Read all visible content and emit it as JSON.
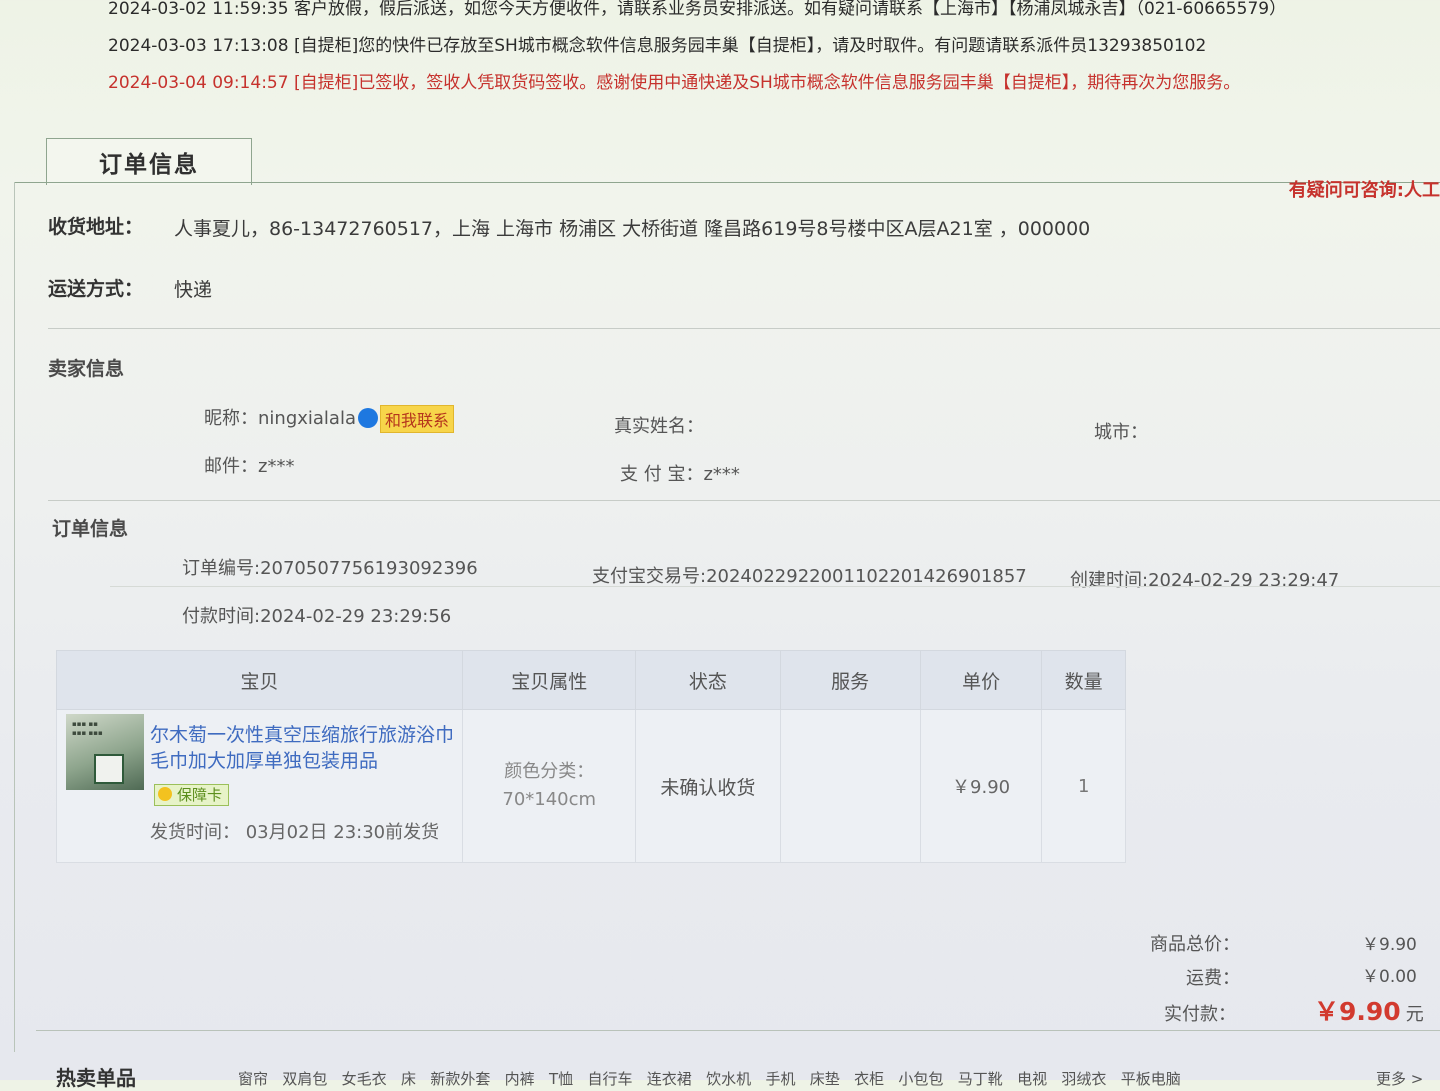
{
  "logistics": [
    {
      "time": "2024-03-02 11:59:35",
      "text": "客户放假，假后派送，如您今天方便收件，请联系业务员安排派送。如有疑问请联系【上海市】【杨浦凤城永吉】（021-60665579）"
    },
    {
      "time": "2024-03-03 17:13:08",
      "text": "[自提柜]您的快件已存放至SH城市概念软件信息服务园丰巢【自提柜】，请及时取件。有问题请联系派件员13293850102"
    },
    {
      "time": "2024-03-04 09:14:57",
      "text": "[自提柜]已签收，签收人凭取货码签收。感谢使用中通快递及SH城市概念软件信息服务园丰巢【自提柜】，期待再次为您服务。"
    }
  ],
  "tab": {
    "label": "订单信息"
  },
  "help": {
    "text": "有疑问可咨询:人工"
  },
  "shipping": {
    "address_label": "收货地址：",
    "address_value": "人事夏儿，86-13472760517，上海 上海市 杨浦区 大桥街道 隆昌路619号8号楼中区A层A21室 ，000000",
    "method_label": "运送方式：",
    "method_value": "快递"
  },
  "seller": {
    "section_title": "卖家信息",
    "nickname_label": "昵称：",
    "nickname": "ningxialala",
    "contact_label": "和我联系",
    "realname_label": "真实姓名：",
    "city_label": "城市：",
    "email_label": "邮件：",
    "email": "z***",
    "alipay_label": "支 付 宝：",
    "alipay": "z***"
  },
  "order": {
    "section_title": "订单信息",
    "order_no_label": "订单编号:",
    "order_no": "2070507756193092396",
    "trade_no_label": "支付宝交易号:",
    "trade_no": "2024022922001102201426901857",
    "created_label": "创建时间:",
    "created": "2024-02-29 23:29:47",
    "paid_label": "付款时间:",
    "paid": "2024-02-29 23:29:56"
  },
  "items_table": {
    "headers": [
      "宝贝",
      "宝贝属性",
      "状态",
      "服务",
      "单价",
      "数量"
    ],
    "rows": [
      {
        "title": "尔木萄一次性真空压缩旅行旅游浴巾毛巾加大加厚单独包装用品",
        "badge": "保障卡",
        "ship_label": "发货时间：",
        "ship_time": "03月02日 23:30前发货",
        "attr_label": "颜色分类：",
        "attr_value": "70*140cm",
        "status": "未确认收货",
        "service": "",
        "price": "￥9.90",
        "qty": "1"
      }
    ]
  },
  "totals": {
    "goods_label": "商品总价：",
    "goods": "￥9.90",
    "freight_label": "运费：",
    "freight": "￥0.00",
    "paid_label": "实付款：",
    "paid": "￥9.90",
    "paid_unit": "元"
  },
  "hot": {
    "title": "热卖单品",
    "links": [
      "窗帘",
      "双肩包",
      "女毛衣",
      "床",
      "新款外套",
      "内裤",
      "T恤",
      "自行车",
      "连衣裙",
      "饮水机",
      "手机",
      "床垫",
      "衣柜",
      "小包包",
      "马丁靴",
      "电视",
      "羽绒衣",
      "平板电脑"
    ],
    "more": "更多 >"
  },
  "colors": {
    "accent_red": "#c6322d",
    "link_blue": "#3f6bc0",
    "tab_border": "#8fa58f"
  }
}
